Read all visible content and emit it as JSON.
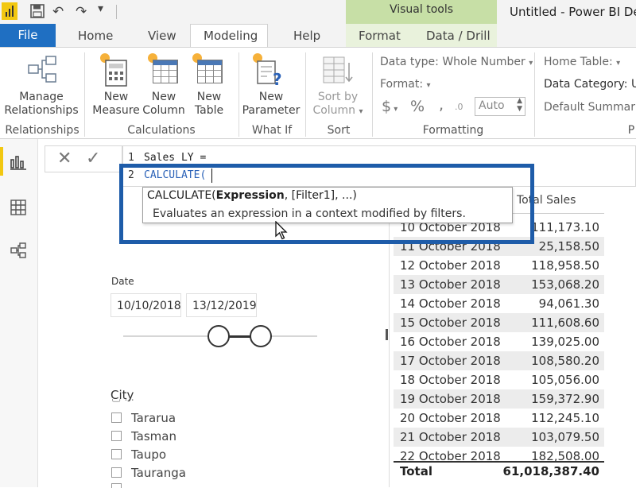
{
  "title_bar": {
    "window_title": "Untitled - Power BI Desk",
    "contextual_group": "Visual tools"
  },
  "tabs": {
    "file": "File",
    "home": "Home",
    "view": "View",
    "modeling": "Modeling",
    "help": "Help",
    "format": "Format",
    "data_drill": "Data / Drill"
  },
  "ribbon": {
    "manage_relationships": [
      "Manage",
      "Relationships"
    ],
    "new_measure": [
      "New",
      "Measure"
    ],
    "new_column": [
      "New",
      "Column"
    ],
    "new_table": [
      "New",
      "Table"
    ],
    "new_parameter": [
      "New",
      "Parameter"
    ],
    "sort_by_column": [
      "Sort by",
      "Column"
    ],
    "data_type": "Data type: Whole Number",
    "format": "Format:",
    "currency_symbol": "$",
    "percent_symbol": "%",
    "comma_symbol": ",",
    "auto": "Auto",
    "home_table": "Home Table:",
    "data_category": "Data Category: Un",
    "default_summarization": "Default Summarizat",
    "groups": {
      "relationships": "Relationships",
      "calculations": "Calculations",
      "what_if": "What If",
      "sort": "Sort",
      "formatting": "Formatting",
      "properties": "P"
    }
  },
  "formula": {
    "line1_no": "1",
    "line1": "Sales LY =",
    "line2_no": "2",
    "line2": "CALCULATE(",
    "tooltip_func": "CALCULATE(",
    "tooltip_param": "Expression",
    "tooltip_rest": ", [Filter1], ...)",
    "tooltip_desc": "Evaluates an expression in a context modified by filters."
  },
  "date_slicer": {
    "label": "Date",
    "start": "10/10/2018",
    "end": "13/12/2019",
    "range_fraction": [
      0.49,
      0.71
    ]
  },
  "city_slicer": {
    "label": "City",
    "items": [
      "Tararua",
      "Tasman",
      "Taupo",
      "Tauranga"
    ]
  },
  "table": {
    "header_value": "Total Sales",
    "rows": [
      {
        "date": "10 October 2018",
        "value": "111,173.10"
      },
      {
        "date": "11 October 2018",
        "value": "25,158.50"
      },
      {
        "date": "12 October 2018",
        "value": "118,958.50"
      },
      {
        "date": "13 October 2018",
        "value": "153,068.20"
      },
      {
        "date": "14 October 2018",
        "value": "94,061.30"
      },
      {
        "date": "15 October 2018",
        "value": "111,608.60"
      },
      {
        "date": "16 October 2018",
        "value": "139,025.00"
      },
      {
        "date": "17 October 2018",
        "value": "108,580.20"
      },
      {
        "date": "18 October 2018",
        "value": "105,056.00"
      },
      {
        "date": "19 October 2018",
        "value": "159,372.90"
      },
      {
        "date": "20 October 2018",
        "value": "112,245.10"
      },
      {
        "date": "21 October 2018",
        "value": "103,079.50"
      },
      {
        "date": "22 October 2018",
        "value": "182,508.00"
      }
    ],
    "total_label": "Total",
    "total_value": "61,018,387.40"
  },
  "colors": {
    "accent_blue": "#1e5ca9",
    "file_tab": "#1f6fc2",
    "visual_tools": "#c7dfa6",
    "dax_keyword": "#2b62b8",
    "powerbi_yellow": "#f2c811"
  }
}
